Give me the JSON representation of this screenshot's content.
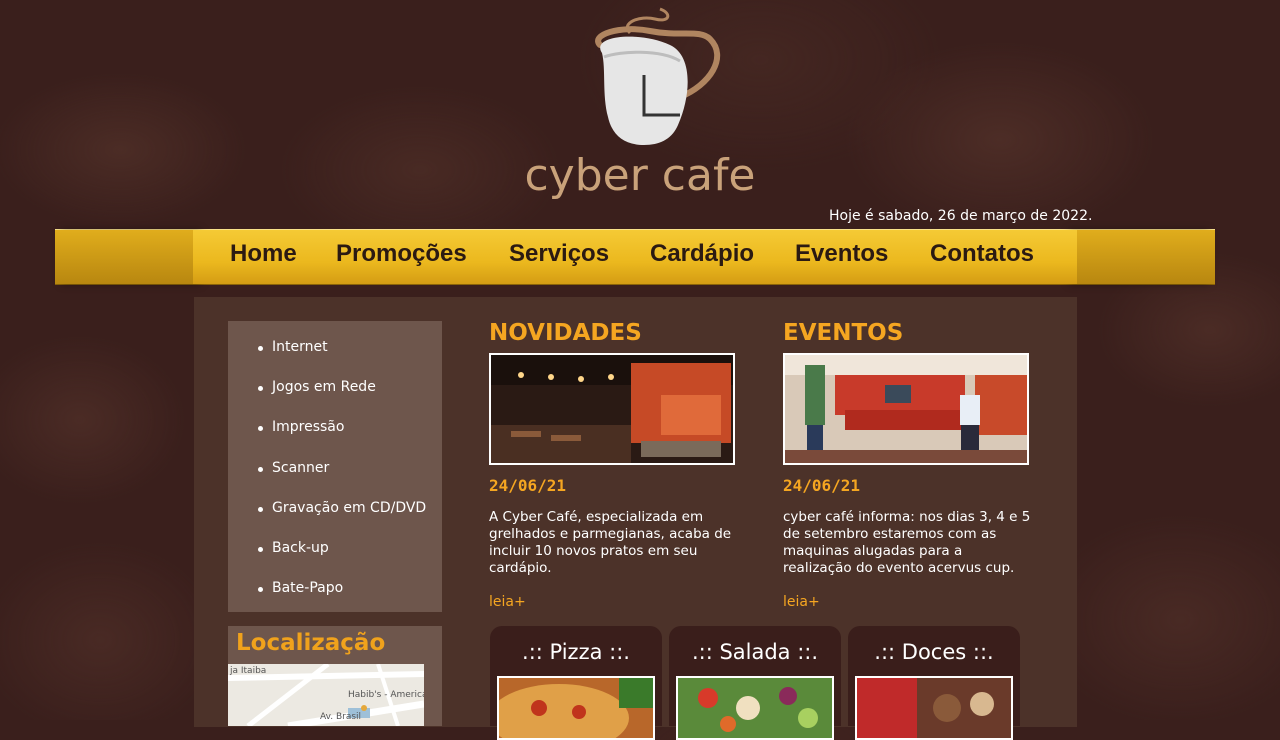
{
  "brand": {
    "name": "cyber cafe"
  },
  "date_text": "Hoje é sabado, 26 de março de 2022.",
  "nav": [
    {
      "label": "Home"
    },
    {
      "label": "Promoções"
    },
    {
      "label": "Serviços"
    },
    {
      "label": "Cardápio"
    },
    {
      "label": "Eventos"
    },
    {
      "label": "Contatos"
    }
  ],
  "sidebar": {
    "items": [
      {
        "label": "Internet"
      },
      {
        "label": "Jogos em Rede"
      },
      {
        "label": "Impressão"
      },
      {
        "label": "Scanner"
      },
      {
        "label": "Gravação em CD/DVD"
      },
      {
        "label": "Back-up"
      },
      {
        "label": "Bate-Papo"
      }
    ],
    "location_title": "Localização",
    "map_labels": [
      "ja Itaiba",
      "Habib's - America",
      "Av. Brasil"
    ]
  },
  "news": {
    "title": "NOVIDADES",
    "date": "24/06/21",
    "text": "A Cyber Café, especializada em grelhados e parmegianas, acaba de incluir 10 novos pratos em seu cardápio.",
    "link": "leia+"
  },
  "events": {
    "title": "EVENTOS",
    "date": "24/06/21",
    "text": "cyber café informa: nos dias 3, 4 e 5 de setembro estaremos com as maquinas alugadas para a realização do evento acervus cup.",
    "link": "leia+"
  },
  "cards": [
    {
      "title": ".:: Pizza ::."
    },
    {
      "title": ".:: Salada ::."
    },
    {
      "title": ".:: Doces ::."
    }
  ],
  "colors": {
    "accent": "#f5a621",
    "nav_gold": "#ebb81e",
    "background": "#3a1f1c",
    "logo_brown": "#c9a27a"
  }
}
